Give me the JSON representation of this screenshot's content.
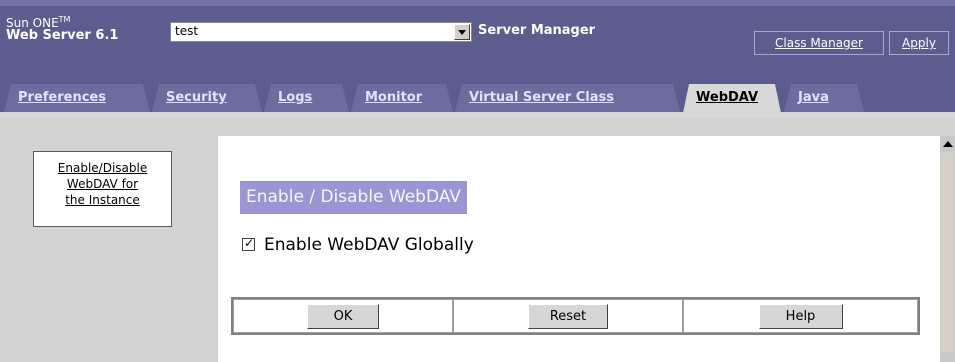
{
  "header": {
    "product_name": "Sun ONE",
    "trademark": "TM",
    "product_version": "Web Server 6.1",
    "server_select": {
      "value": "test"
    },
    "app_name": "Server Manager",
    "buttons": {
      "class_manager": "Class Manager",
      "apply": "Apply"
    }
  },
  "tabs": [
    {
      "label": "Preferences",
      "active": false
    },
    {
      "label": "Security",
      "active": false
    },
    {
      "label": "Logs",
      "active": false
    },
    {
      "label": "Monitor",
      "active": false
    },
    {
      "label": "Virtual Server Class",
      "active": false
    },
    {
      "label": "WebDAV",
      "active": true
    },
    {
      "label": "Java",
      "active": false
    }
  ],
  "sidebar": {
    "link_lines": [
      "Enable/Disable",
      "WebDAV for",
      "the Instance"
    ]
  },
  "content": {
    "title": "Enable / Disable WebDAV",
    "enable_checkbox": {
      "label": "Enable WebDAV Globally",
      "checked": true
    },
    "buttons": {
      "ok": "OK",
      "reset": "Reset",
      "help": "Help"
    }
  },
  "colors": {
    "header_bg": "#5c5c8f",
    "tab_bg": "#6c6ca0",
    "title_bg": "#9b96d3",
    "body_bg": "#d2d2d2"
  }
}
